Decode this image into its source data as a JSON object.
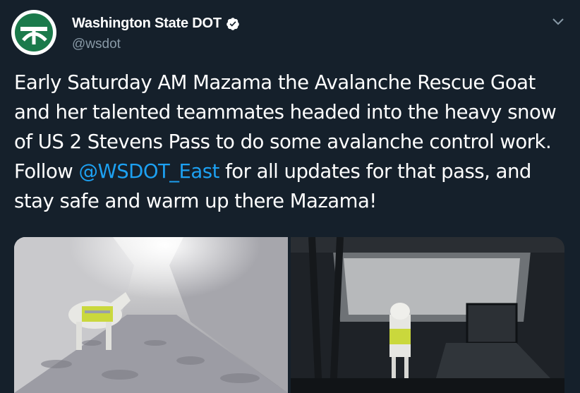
{
  "account": {
    "display_name": "Washington State DOT",
    "handle": "@wsdot",
    "verified": true,
    "avatar_icon": "wsdot-logo-icon",
    "brand_color": "#1b7a4b"
  },
  "tweet": {
    "text_before_mention": "Early Saturday AM Mazama the Avalanche Rescue Goat and her talented teammates headed into the heavy snow of US 2 Stevens Pass to do some avalanche control work. Follow ",
    "mention": "@WSDOT_East",
    "text_after_mention": " for all updates for that pass, and stay safe and warm up there Mazama!",
    "mention_color": "#1da1f2"
  },
  "media": [
    {
      "alt_icon": "goat-in-snow-tunnel-photo"
    },
    {
      "alt_icon": "goat-in-vehicle-photo"
    }
  ],
  "theme": {
    "background": "#15202b",
    "secondary_text": "#8899a6"
  }
}
